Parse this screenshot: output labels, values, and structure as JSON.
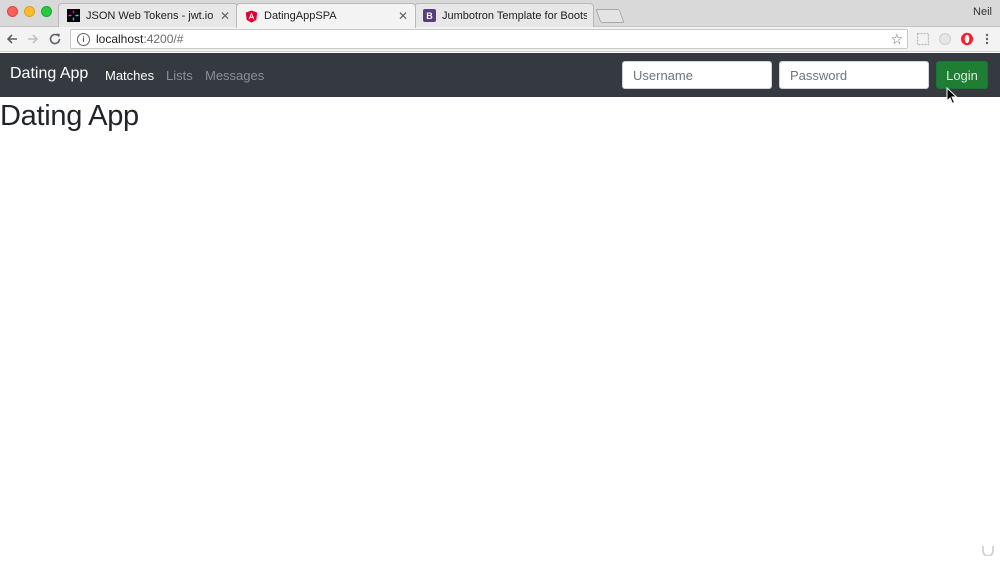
{
  "browser": {
    "tabs": [
      {
        "label": "JSON Web Tokens - jwt.io",
        "icon": "jwt-icon",
        "active": false
      },
      {
        "label": "DatingAppSPA",
        "icon": "angular-icon",
        "active": true
      },
      {
        "label": "Jumbotron Template for Bootstrap",
        "icon": "bootstrap-icon",
        "active": false
      }
    ],
    "profile_name": "Neil",
    "address": {
      "host": "localhost",
      "path": ":4200/#"
    }
  },
  "navbar": {
    "brand": "Dating App",
    "links": [
      {
        "label": "Matches",
        "active": true
      },
      {
        "label": "Lists",
        "active": false
      },
      {
        "label": "Messages",
        "active": false
      }
    ],
    "username_placeholder": "Username",
    "password_placeholder": "Password",
    "login_label": "Login"
  },
  "main": {
    "title": "Dating App"
  },
  "colors": {
    "navbar_bg": "#343a40",
    "login_button": "#1e7e34",
    "text": "#212529"
  }
}
